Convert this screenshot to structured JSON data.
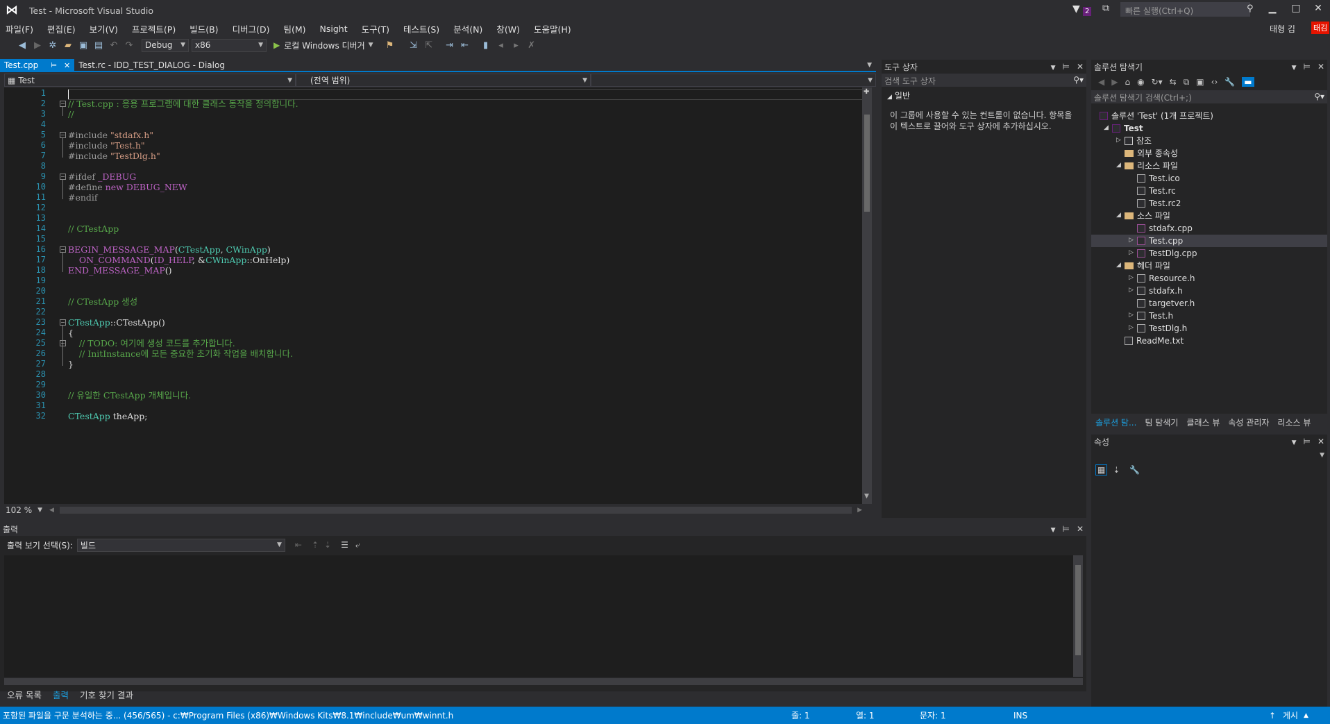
{
  "window": {
    "title": "Test - Microsoft Visual Studio",
    "filter_count": "2",
    "quick_launch_placeholder": "빠른 실행(Ctrl+Q)",
    "user": "태형 김",
    "user_badge": "태김"
  },
  "menu": [
    "파일(F)",
    "편집(E)",
    "보기(V)",
    "프로젝트(P)",
    "빌드(B)",
    "디버그(D)",
    "팀(M)",
    "Nsight",
    "도구(T)",
    "테스트(S)",
    "분석(N)",
    "창(W)",
    "도움말(H)"
  ],
  "toolbar": {
    "config": "Debug",
    "platform": "x86",
    "run_label": "로컬 Windows 디버거"
  },
  "editor": {
    "tabs": [
      {
        "label": "Test.cpp",
        "active": true
      },
      {
        "label": "Test.rc - IDD_TEST_DIALOG - Dialog",
        "active": false
      }
    ],
    "nav_project": "Test",
    "nav_scope": "(전역 범위)",
    "zoom": "102 %",
    "lines": [
      [],
      [
        {
          "t": "// Test.cpp : 응용 프로그램에 대한 클래스 동작을 정의합니다.",
          "c": "com"
        }
      ],
      [
        {
          "t": "//",
          "c": "com"
        }
      ],
      [],
      [
        {
          "t": "#include ",
          "c": "pre"
        },
        {
          "t": "\"stdafx.h\"",
          "c": "str"
        }
      ],
      [
        {
          "t": "#include ",
          "c": "pre"
        },
        {
          "t": "\"Test.h\"",
          "c": "str"
        }
      ],
      [
        {
          "t": "#include ",
          "c": "pre"
        },
        {
          "t": "\"TestDlg.h\"",
          "c": "str"
        }
      ],
      [],
      [
        {
          "t": "#ifdef ",
          "c": "pre"
        },
        {
          "t": "_DEBUG",
          "c": "mac"
        }
      ],
      [
        {
          "t": "#define ",
          "c": "pre"
        },
        {
          "t": "new DEBUG_NEW",
          "c": "mac"
        }
      ],
      [
        {
          "t": "#endif",
          "c": "pre"
        }
      ],
      [],
      [],
      [
        {
          "t": "// CTestApp",
          "c": "com"
        }
      ],
      [],
      [
        {
          "t": "BEGIN_MESSAGE_MAP",
          "c": "mac"
        },
        {
          "t": "(",
          "c": "def"
        },
        {
          "t": "CTestApp",
          "c": "type"
        },
        {
          "t": ", ",
          "c": "def"
        },
        {
          "t": "CWinApp",
          "c": "type"
        },
        {
          "t": ")",
          "c": "def"
        }
      ],
      [
        {
          "t": "    ON_COMMAND",
          "c": "mac"
        },
        {
          "t": "(",
          "c": "def"
        },
        {
          "t": "ID_HELP",
          "c": "mac"
        },
        {
          "t": ", &",
          "c": "def"
        },
        {
          "t": "CWinApp",
          "c": "type"
        },
        {
          "t": "::OnHelp)",
          "c": "def"
        }
      ],
      [
        {
          "t": "END_MESSAGE_MAP",
          "c": "mac"
        },
        {
          "t": "()",
          "c": "def"
        }
      ],
      [],
      [],
      [
        {
          "t": "// CTestApp 생성",
          "c": "com"
        }
      ],
      [],
      [
        {
          "t": "CTestApp",
          "c": "type"
        },
        {
          "t": "::CTestApp()",
          "c": "def"
        }
      ],
      [
        {
          "t": "{",
          "c": "def"
        }
      ],
      [
        {
          "t": "    // TODO: 여기에 생성 코드를 추가합니다.",
          "c": "com"
        }
      ],
      [
        {
          "t": "    // InitInstance에 모든 중요한 초기화 작업을 배치합니다.",
          "c": "com"
        }
      ],
      [
        {
          "t": "}",
          "c": "def"
        }
      ],
      [],
      [],
      [
        {
          "t": "// 유일한 CTestApp 개체입니다.",
          "c": "com"
        }
      ],
      [],
      [
        {
          "t": "CTestApp",
          "c": "type"
        },
        {
          "t": " theApp;",
          "c": "def"
        }
      ]
    ]
  },
  "toolbox": {
    "title": "도구 상자",
    "search_placeholder": "검색 도구 상자",
    "group": "일반",
    "empty_message": "이 그룹에 사용할 수 있는 컨트롤이 없습니다. 항목을 이 텍스트로 끌어와 도구 상자에 추가하십시오."
  },
  "solution_explorer": {
    "title": "솔루션 탐색기",
    "search_placeholder": "솔루션 탐색기 검색(Ctrl+;)",
    "items": [
      {
        "label": "솔루션 'Test' (1개 프로젝트)",
        "indent": 0,
        "exp": "",
        "icon": "solution",
        "bold": false
      },
      {
        "label": "Test",
        "indent": 1,
        "exp": "open",
        "icon": "project",
        "bold": true
      },
      {
        "label": "참조",
        "indent": 2,
        "exp": "closed",
        "icon": "refs",
        "bold": false
      },
      {
        "label": "외부 종속성",
        "indent": 2,
        "exp": "",
        "icon": "folder",
        "bold": false
      },
      {
        "label": "리소스 파일",
        "indent": 2,
        "exp": "open",
        "icon": "folder",
        "bold": false
      },
      {
        "label": "Test.ico",
        "indent": 3,
        "exp": "",
        "icon": "file",
        "bold": false
      },
      {
        "label": "Test.rc",
        "indent": 3,
        "exp": "",
        "icon": "file",
        "bold": false
      },
      {
        "label": "Test.rc2",
        "indent": 3,
        "exp": "",
        "icon": "file",
        "bold": false
      },
      {
        "label": "소스 파일",
        "indent": 2,
        "exp": "open",
        "icon": "folder",
        "bold": false
      },
      {
        "label": "stdafx.cpp",
        "indent": 3,
        "exp": "",
        "icon": "cpp",
        "bold": false
      },
      {
        "label": "Test.cpp",
        "indent": 3,
        "exp": "closed",
        "icon": "cpp",
        "bold": false,
        "selected": true
      },
      {
        "label": "TestDlg.cpp",
        "indent": 3,
        "exp": "closed",
        "icon": "cpp",
        "bold": false
      },
      {
        "label": "헤더 파일",
        "indent": 2,
        "exp": "open",
        "icon": "folder",
        "bold": false
      },
      {
        "label": "Resource.h",
        "indent": 3,
        "exp": "closed",
        "icon": "file",
        "bold": false
      },
      {
        "label": "stdafx.h",
        "indent": 3,
        "exp": "closed",
        "icon": "file",
        "bold": false
      },
      {
        "label": "targetver.h",
        "indent": 3,
        "exp": "",
        "icon": "file",
        "bold": false
      },
      {
        "label": "Test.h",
        "indent": 3,
        "exp": "closed",
        "icon": "file",
        "bold": false
      },
      {
        "label": "TestDlg.h",
        "indent": 3,
        "exp": "closed",
        "icon": "file",
        "bold": false
      },
      {
        "label": "ReadMe.txt",
        "indent": 2,
        "exp": "",
        "icon": "file",
        "bold": false
      }
    ],
    "tabs": [
      "솔루션 탐...",
      "팀 탐색기",
      "클래스 뷰",
      "속성 관리자",
      "리소스 뷰"
    ]
  },
  "properties": {
    "title": "속성"
  },
  "output": {
    "title": "출력",
    "source_label": "출력 보기 선택(S):",
    "source_value": "빌드"
  },
  "bottom_tabs": [
    "오류 목록",
    "출력",
    "기호 찾기 결과"
  ],
  "status": {
    "message": "포함된 파일을 구문 분석하는 중... (456/565) - c:₩Program Files (x86)₩Windows Kits₩8.1₩include₩um₩winnt.h",
    "line": "줄: 1",
    "col": "열: 1",
    "ch": "문자: 1",
    "mode": "INS",
    "publish": "게시"
  }
}
